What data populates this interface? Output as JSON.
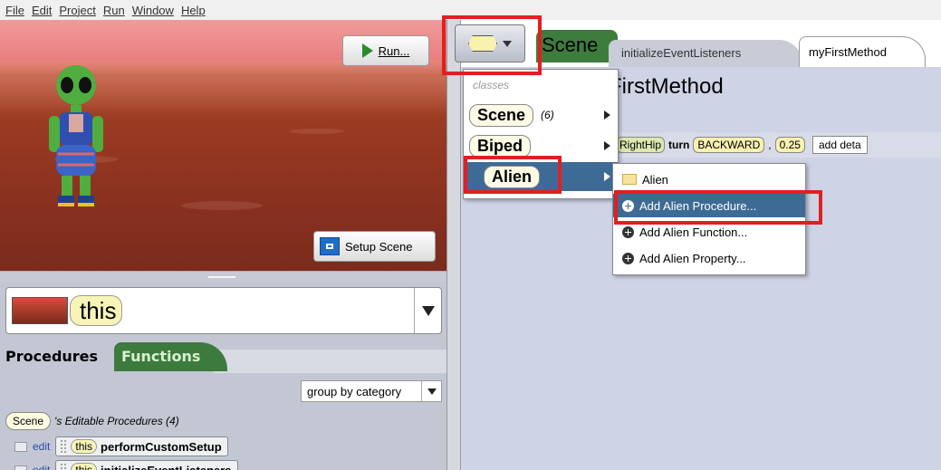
{
  "menubar": {
    "items": [
      "File",
      "Edit",
      "Project",
      "Run",
      "Window",
      "Help"
    ]
  },
  "scene_view": {
    "run_label": "Run...",
    "setup_label": "Setup Scene"
  },
  "instance_combo": {
    "value": "this"
  },
  "left_tabs": {
    "procedures": "Procedures",
    "functions": "Functions"
  },
  "group_combo": {
    "value": "group by category"
  },
  "editable_header": {
    "chip": "Scene",
    "text": "'s Editable Procedures (4)"
  },
  "procedures": [
    {
      "edit": "edit",
      "this": "this",
      "name": "performCustomSetup"
    },
    {
      "edit": "edit",
      "this": "this",
      "name": "initializeEventListeners"
    }
  ],
  "right_tabs": {
    "scene": "Scene",
    "init": "initializeEventListeners",
    "first": "myFirstMethod"
  },
  "method_title": "FirstMethod",
  "statement": {
    "hip": "RightHip",
    "verb": "turn",
    "direction": "BACKWARD",
    "amount": "0.25",
    "add_detail": "add deta"
  },
  "class_menu": {
    "caption": "classes",
    "items": [
      {
        "label": "Scene",
        "count": "(6)"
      },
      {
        "label": "Biped",
        "count": ""
      },
      {
        "label": "Alien",
        "count": ""
      }
    ]
  },
  "alien_submenu": {
    "folder": "Alien",
    "items": [
      "Add Alien Procedure...",
      "Add Alien Function...",
      "Add Alien Property..."
    ]
  }
}
